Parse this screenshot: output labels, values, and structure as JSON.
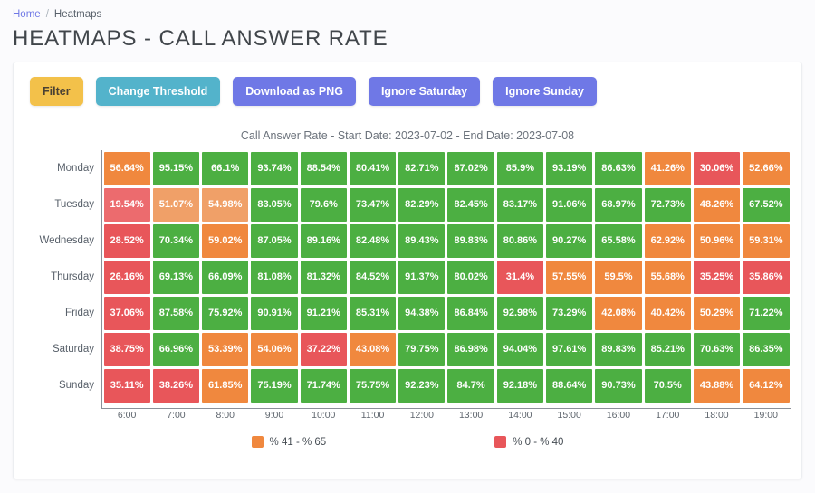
{
  "breadcrumb": {
    "home": "Home",
    "separator": "/",
    "current": "Heatmaps"
  },
  "page": {
    "title": "Heatmaps - Call Answer Rate"
  },
  "toolbar": {
    "filter_label": "Filter",
    "threshold_label": "Change Threshold",
    "download_label": "Download as PNG",
    "ignore_saturday_label": "Ignore Saturday",
    "ignore_sunday_label": "Ignore Sunday"
  },
  "legend": [
    {
      "label": "% 41 - % 65",
      "color": "#f0883e"
    },
    {
      "label": "% 0 - % 40",
      "color": "#e8565a"
    }
  ],
  "colors": {
    "green": "#4caf42",
    "orange": "#f0883e",
    "orange_light": "#f0a068",
    "red": "#e8565a",
    "red_light": "#ec6b6e",
    "brand": "#6f78e6",
    "filter": "#f3c14a",
    "threshold": "#53b3cb"
  },
  "chart_data": {
    "type": "heatmap",
    "title": "Call Answer Rate - Start Date: 2023-07-02 - End Date: 2023-07-08",
    "xlabel": "",
    "ylabel": "",
    "grid": false,
    "legend_position": "bottom",
    "x": [
      "6:00",
      "7:00",
      "8:00",
      "9:00",
      "10:00",
      "11:00",
      "12:00",
      "13:00",
      "14:00",
      "15:00",
      "16:00",
      "17:00",
      "18:00",
      "19:00"
    ],
    "categories": [
      "6:00",
      "7:00",
      "8:00",
      "9:00",
      "10:00",
      "11:00",
      "12:00",
      "13:00",
      "14:00",
      "15:00",
      "16:00",
      "17:00",
      "18:00",
      "19:00"
    ],
    "y": [
      "Monday",
      "Tuesday",
      "Wednesday",
      "Thursday",
      "Friday",
      "Saturday",
      "Sunday"
    ],
    "thresholds": {
      "low_max": 40,
      "mid_max": 65
    },
    "series": [
      {
        "name": "Monday",
        "values": [
          56.64,
          95.15,
          66.1,
          93.74,
          88.54,
          80.41,
          82.71,
          67.02,
          85.9,
          93.19,
          86.63,
          41.26,
          30.06,
          52.66
        ]
      },
      {
        "name": "Tuesday",
        "values": [
          19.54,
          51.07,
          54.98,
          83.05,
          79.6,
          73.47,
          82.29,
          82.45,
          83.17,
          91.06,
          68.97,
          72.73,
          48.26,
          67.52
        ]
      },
      {
        "name": "Wednesday",
        "values": [
          28.52,
          70.34,
          59.02,
          87.05,
          89.16,
          82.48,
          89.43,
          89.83,
          80.86,
          90.27,
          65.58,
          62.92,
          50.96,
          59.31
        ]
      },
      {
        "name": "Thursday",
        "values": [
          26.16,
          69.13,
          66.09,
          81.08,
          81.32,
          84.52,
          91.37,
          80.02,
          31.4,
          57.55,
          59.5,
          55.68,
          35.25,
          35.86
        ]
      },
      {
        "name": "Friday",
        "values": [
          37.06,
          87.58,
          75.92,
          90.91,
          91.21,
          85.31,
          94.38,
          86.84,
          92.98,
          73.29,
          42.08,
          40.42,
          50.29,
          71.22
        ]
      },
      {
        "name": "Saturday",
        "values": [
          38.75,
          66.96,
          53.39,
          54.06,
          37.22,
          43.08,
          79.75,
          86.98,
          94.04,
          97.61,
          89.83,
          85.21,
          70.63,
          86.35
        ]
      },
      {
        "name": "Sunday",
        "values": [
          35.11,
          38.26,
          61.85,
          75.19,
          71.74,
          75.75,
          92.23,
          84.7,
          92.18,
          88.64,
          90.73,
          70.5,
          43.88,
          64.12
        ]
      }
    ],
    "rows": [
      {
        "label": "Monday",
        "cells": [
          {
            "text": "56.64%",
            "color": "#f0883e"
          },
          {
            "text": "95.15%",
            "color": "#4caf42"
          },
          {
            "text": "66.1%",
            "color": "#4caf42"
          },
          {
            "text": "93.74%",
            "color": "#4caf42"
          },
          {
            "text": "88.54%",
            "color": "#4caf42"
          },
          {
            "text": "80.41%",
            "color": "#4caf42"
          },
          {
            "text": "82.71%",
            "color": "#4caf42"
          },
          {
            "text": "67.02%",
            "color": "#4caf42"
          },
          {
            "text": "85.9%",
            "color": "#4caf42"
          },
          {
            "text": "93.19%",
            "color": "#4caf42"
          },
          {
            "text": "86.63%",
            "color": "#4caf42"
          },
          {
            "text": "41.26%",
            "color": "#f0883e"
          },
          {
            "text": "30.06%",
            "color": "#e8565a"
          },
          {
            "text": "52.66%",
            "color": "#f0883e"
          }
        ]
      },
      {
        "label": "Tuesday",
        "cells": [
          {
            "text": "19.54%",
            "color": "#ec6b6e"
          },
          {
            "text": "51.07%",
            "color": "#f0a068"
          },
          {
            "text": "54.98%",
            "color": "#f0a068"
          },
          {
            "text": "83.05%",
            "color": "#4caf42"
          },
          {
            "text": "79.6%",
            "color": "#4caf42"
          },
          {
            "text": "73.47%",
            "color": "#4caf42"
          },
          {
            "text": "82.29%",
            "color": "#4caf42"
          },
          {
            "text": "82.45%",
            "color": "#4caf42"
          },
          {
            "text": "83.17%",
            "color": "#4caf42"
          },
          {
            "text": "91.06%",
            "color": "#4caf42"
          },
          {
            "text": "68.97%",
            "color": "#4caf42"
          },
          {
            "text": "72.73%",
            "color": "#4caf42"
          },
          {
            "text": "48.26%",
            "color": "#f0883e"
          },
          {
            "text": "67.52%",
            "color": "#4caf42"
          }
        ]
      },
      {
        "label": "Wednesday",
        "cells": [
          {
            "text": "28.52%",
            "color": "#e8565a"
          },
          {
            "text": "70.34%",
            "color": "#4caf42"
          },
          {
            "text": "59.02%",
            "color": "#f0883e"
          },
          {
            "text": "87.05%",
            "color": "#4caf42"
          },
          {
            "text": "89.16%",
            "color": "#4caf42"
          },
          {
            "text": "82.48%",
            "color": "#4caf42"
          },
          {
            "text": "89.43%",
            "color": "#4caf42"
          },
          {
            "text": "89.83%",
            "color": "#4caf42"
          },
          {
            "text": "80.86%",
            "color": "#4caf42"
          },
          {
            "text": "90.27%",
            "color": "#4caf42"
          },
          {
            "text": "65.58%",
            "color": "#4caf42"
          },
          {
            "text": "62.92%",
            "color": "#f0883e"
          },
          {
            "text": "50.96%",
            "color": "#f0883e"
          },
          {
            "text": "59.31%",
            "color": "#f0883e"
          }
        ]
      },
      {
        "label": "Thursday",
        "cells": [
          {
            "text": "26.16%",
            "color": "#e8565a"
          },
          {
            "text": "69.13%",
            "color": "#4caf42"
          },
          {
            "text": "66.09%",
            "color": "#4caf42"
          },
          {
            "text": "81.08%",
            "color": "#4caf42"
          },
          {
            "text": "81.32%",
            "color": "#4caf42"
          },
          {
            "text": "84.52%",
            "color": "#4caf42"
          },
          {
            "text": "91.37%",
            "color": "#4caf42"
          },
          {
            "text": "80.02%",
            "color": "#4caf42"
          },
          {
            "text": "31.4%",
            "color": "#e8565a"
          },
          {
            "text": "57.55%",
            "color": "#f0883e"
          },
          {
            "text": "59.5%",
            "color": "#f0883e"
          },
          {
            "text": "55.68%",
            "color": "#f0883e"
          },
          {
            "text": "35.25%",
            "color": "#e8565a"
          },
          {
            "text": "35.86%",
            "color": "#e8565a"
          }
        ]
      },
      {
        "label": "Friday",
        "cells": [
          {
            "text": "37.06%",
            "color": "#e8565a"
          },
          {
            "text": "87.58%",
            "color": "#4caf42"
          },
          {
            "text": "75.92%",
            "color": "#4caf42"
          },
          {
            "text": "90.91%",
            "color": "#4caf42"
          },
          {
            "text": "91.21%",
            "color": "#4caf42"
          },
          {
            "text": "85.31%",
            "color": "#4caf42"
          },
          {
            "text": "94.38%",
            "color": "#4caf42"
          },
          {
            "text": "86.84%",
            "color": "#4caf42"
          },
          {
            "text": "92.98%",
            "color": "#4caf42"
          },
          {
            "text": "73.29%",
            "color": "#4caf42"
          },
          {
            "text": "42.08%",
            "color": "#f0883e"
          },
          {
            "text": "40.42%",
            "color": "#f0883e"
          },
          {
            "text": "50.29%",
            "color": "#f0883e"
          },
          {
            "text": "71.22%",
            "color": "#4caf42"
          }
        ]
      },
      {
        "label": "Saturday",
        "cells": [
          {
            "text": "38.75%",
            "color": "#e8565a"
          },
          {
            "text": "66.96%",
            "color": "#4caf42"
          },
          {
            "text": "53.39%",
            "color": "#f0883e"
          },
          {
            "text": "54.06%",
            "color": "#f0883e"
          },
          {
            "text": "37.22%",
            "color": "#e8565a"
          },
          {
            "text": "43.08%",
            "color": "#f0883e"
          },
          {
            "text": "79.75%",
            "color": "#4caf42"
          },
          {
            "text": "86.98%",
            "color": "#4caf42"
          },
          {
            "text": "94.04%",
            "color": "#4caf42"
          },
          {
            "text": "97.61%",
            "color": "#4caf42"
          },
          {
            "text": "89.83%",
            "color": "#4caf42"
          },
          {
            "text": "85.21%",
            "color": "#4caf42"
          },
          {
            "text": "70.63%",
            "color": "#4caf42"
          },
          {
            "text": "86.35%",
            "color": "#4caf42"
          }
        ]
      },
      {
        "label": "Sunday",
        "cells": [
          {
            "text": "35.11%",
            "color": "#e8565a"
          },
          {
            "text": "38.26%",
            "color": "#e8565a"
          },
          {
            "text": "61.85%",
            "color": "#f0883e"
          },
          {
            "text": "75.19%",
            "color": "#4caf42"
          },
          {
            "text": "71.74%",
            "color": "#4caf42"
          },
          {
            "text": "75.75%",
            "color": "#4caf42"
          },
          {
            "text": "92.23%",
            "color": "#4caf42"
          },
          {
            "text": "84.7%",
            "color": "#4caf42"
          },
          {
            "text": "92.18%",
            "color": "#4caf42"
          },
          {
            "text": "88.64%",
            "color": "#4caf42"
          },
          {
            "text": "90.73%",
            "color": "#4caf42"
          },
          {
            "text": "70.5%",
            "color": "#4caf42"
          },
          {
            "text": "43.88%",
            "color": "#f0883e"
          },
          {
            "text": "64.12%",
            "color": "#f0883e"
          }
        ]
      }
    ]
  }
}
